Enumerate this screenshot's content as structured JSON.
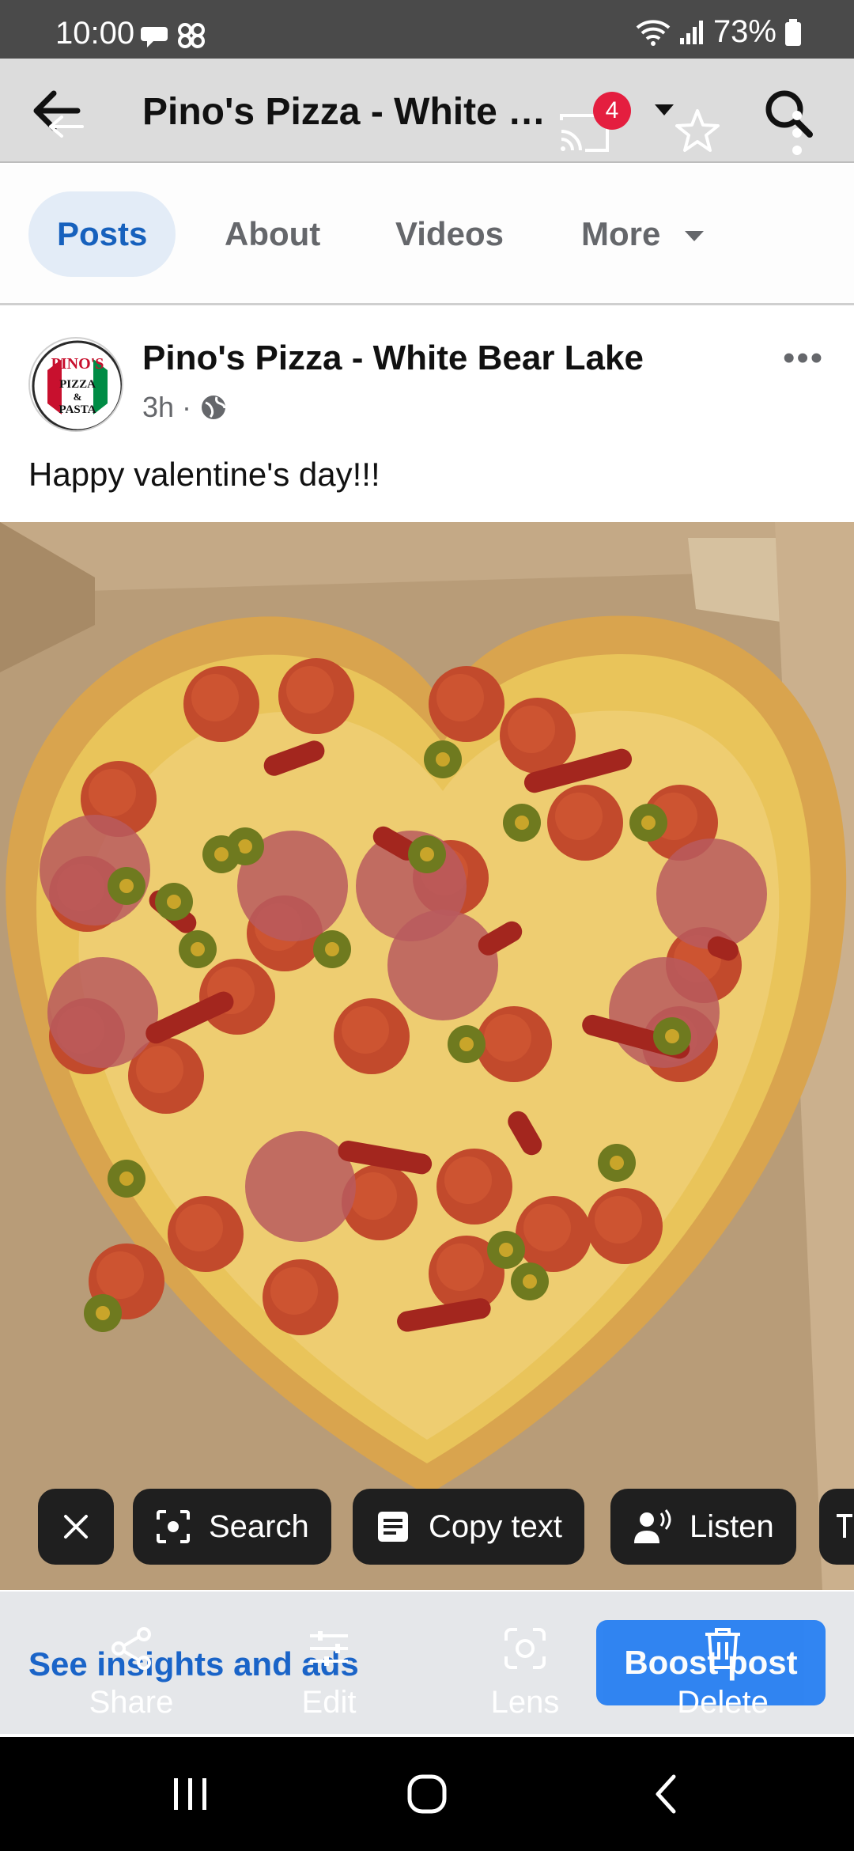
{
  "status_bar": {
    "time": "10:00",
    "battery": "73%"
  },
  "app_bar": {
    "title": "Pino's Pizza - White Bear Lake",
    "notification_count": "4"
  },
  "tabs": [
    {
      "label": "Posts",
      "active": true
    },
    {
      "label": "About",
      "active": false
    },
    {
      "label": "Videos",
      "active": false
    },
    {
      "label": "More",
      "active": false
    }
  ],
  "post": {
    "author": "Pino's Pizza - White Bear Lake",
    "time_ago": "3h",
    "separator": "·",
    "text": "Happy valentine's day!!!",
    "menu": "•••",
    "avatar_logo": {
      "line1": "PINO'S",
      "line2": "PIZZA",
      "line3": "&",
      "line4": "PASTA"
    }
  },
  "lens_chips": {
    "search": "Search",
    "copy_text": "Copy text",
    "listen": "Listen"
  },
  "bottom": {
    "insights": "See insights and ads",
    "boost": "Boost post",
    "actions": {
      "share": "Share",
      "edit": "Edit",
      "lens": "Lens",
      "delete": "Delete"
    }
  },
  "colors": {
    "accent": "#1877f2",
    "badge": "#e41e3f",
    "status_bar": "#4a4a4a",
    "chip": "#1f1f1f"
  }
}
